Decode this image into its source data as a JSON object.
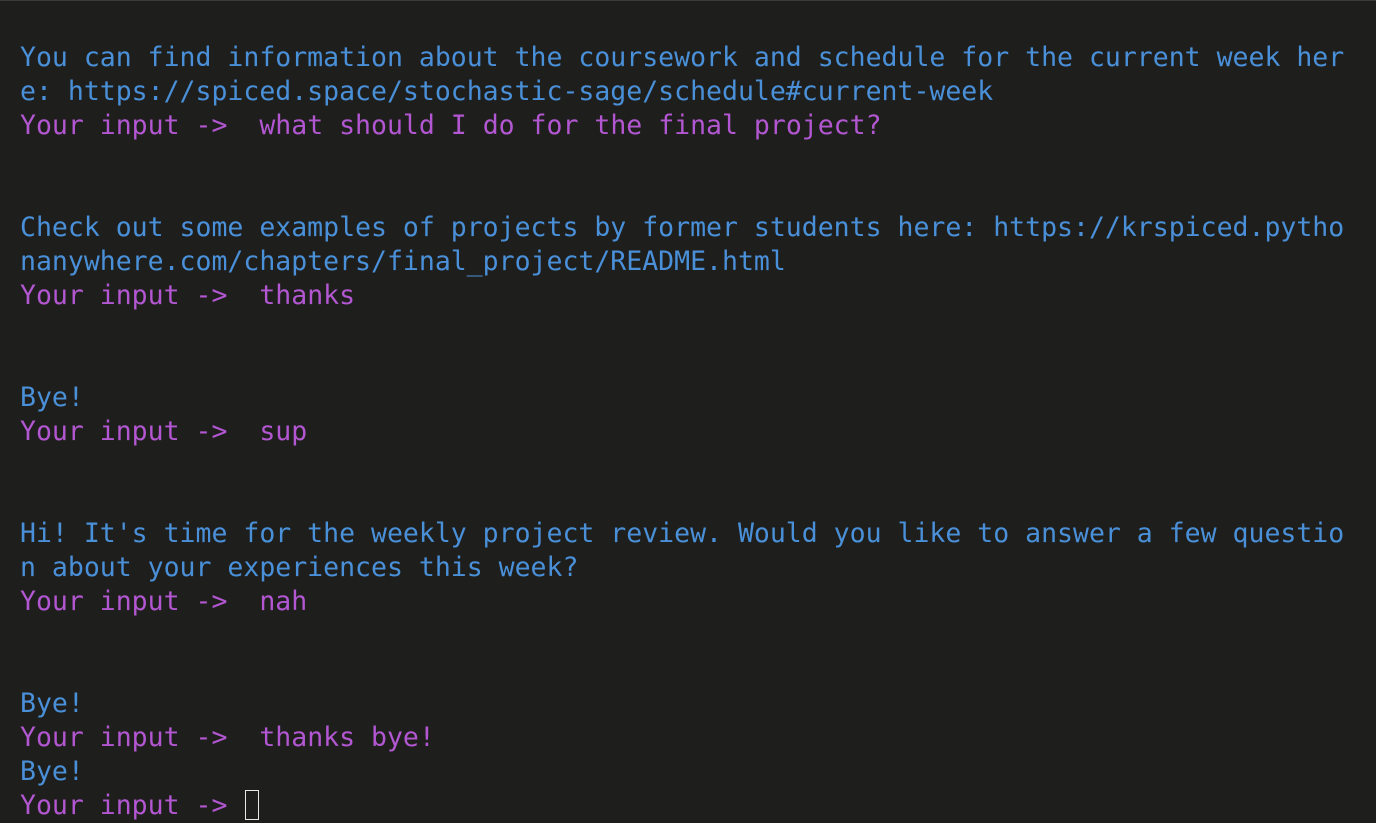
{
  "terminal": {
    "prompt_label": "Your input -> ",
    "lines": [
      {
        "kind": "output",
        "text": "You can find information about the coursework and schedule for the current week her"
      },
      {
        "kind": "output",
        "text": "e: https://spiced.space/stochastic-sage/schedule#current-week"
      },
      {
        "kind": "input",
        "text": " what should I do for the final project?"
      },
      {
        "kind": "output",
        "text": "Check out some examples of projects by former students here: https://krspiced.pytho"
      },
      {
        "kind": "output",
        "text": "nanywhere.com/chapters/final_project/README.html"
      },
      {
        "kind": "input",
        "text": " thanks"
      },
      {
        "kind": "output",
        "text": "Bye!"
      },
      {
        "kind": "input",
        "text": " sup"
      },
      {
        "kind": "output",
        "text": "Hi! It's time for the weekly project review. Would you like to answer a few questio"
      },
      {
        "kind": "output",
        "text": "n about your experiences this week?"
      },
      {
        "kind": "input",
        "text": " nah"
      },
      {
        "kind": "output",
        "text": "Bye!"
      },
      {
        "kind": "input",
        "text": " thanks bye!"
      },
      {
        "kind": "output",
        "text": "Bye!"
      }
    ],
    "colors": {
      "background": "#1e1e1c",
      "output_text": "#4a90d9",
      "prompt_text": "#b257d1",
      "cursor": "#e8e8e8"
    }
  }
}
